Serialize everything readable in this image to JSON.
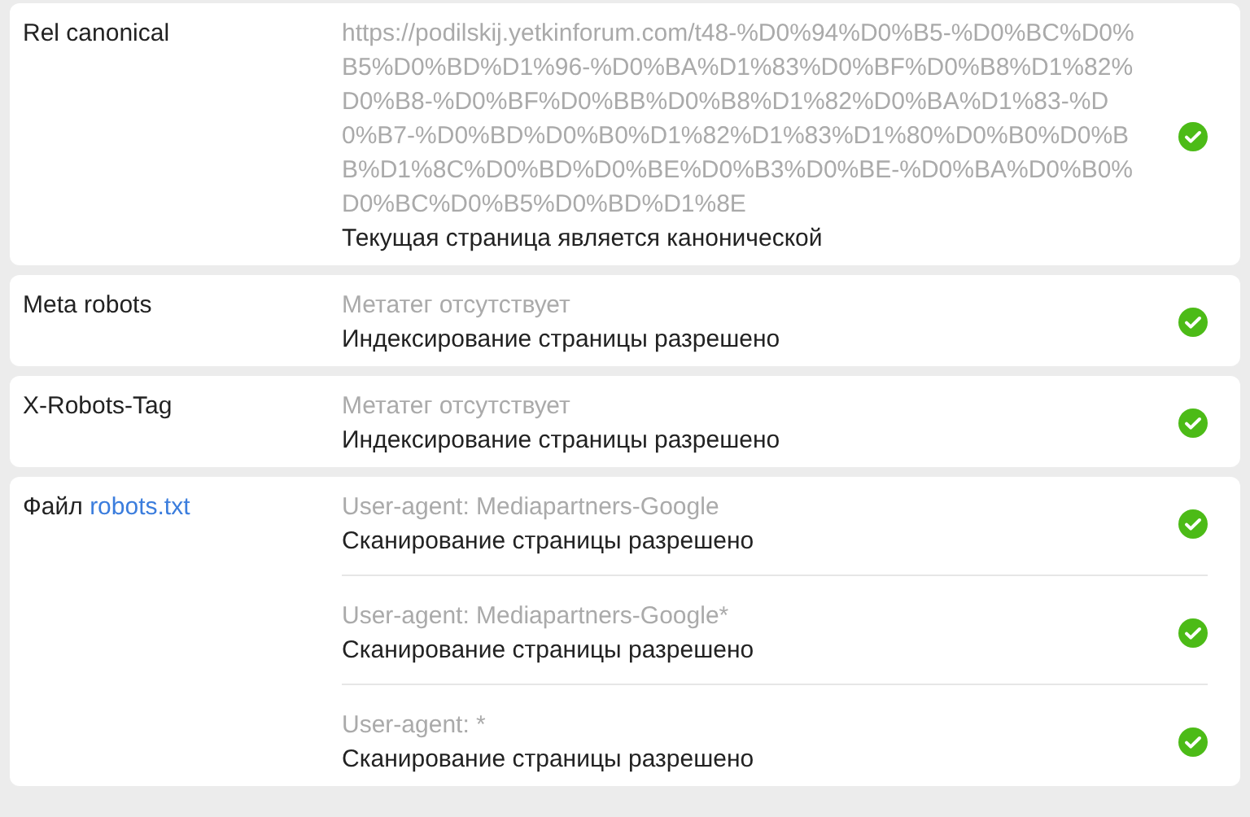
{
  "rows": [
    {
      "label": "Rel canonical",
      "entries": [
        {
          "detail": "https://podilskij.yetkinforum.com/t48-%D0%94%D0%B5-%D0%BC%D0%B5%D0%BD%D1%96-%D0%BA%D1%83%D0%BF%D0%B8%D1%82%D0%B8-%D0%BF%D0%BB%D0%B8%D1%82%D0%BA%D1%83-%D0%B7-%D0%BD%D0%B0%D1%82%D1%83%D1%80%D0%B0%D0%BB%D1%8C%D0%BD%D0%BE%D0%B3%D0%BE-%D0%BA%D0%B0%D0%BC%D0%B5%D0%BD%D1%8E",
          "result": "Текущая страница является канонической",
          "passed": true
        }
      ]
    },
    {
      "label": "Meta robots",
      "entries": [
        {
          "detail": "Метатег отсутствует",
          "result": "Индексирование страницы разрешено",
          "passed": true
        }
      ]
    },
    {
      "label": "X-Robots-Tag",
      "entries": [
        {
          "detail": "Метатег отсутствует",
          "result": "Индексирование страницы разрешено",
          "passed": true
        }
      ]
    },
    {
      "label": "Файл",
      "link": "robots.txt",
      "entries": [
        {
          "detail": "User-agent: Mediapartners-Google",
          "result": "Сканирование страницы разрешено",
          "passed": true
        },
        {
          "detail": "User-agent: Mediapartners-Google*",
          "result": "Сканирование страницы разрешено",
          "passed": true
        },
        {
          "detail": "User-agent: *",
          "result": "Сканирование страницы разрешено",
          "passed": true
        }
      ]
    }
  ]
}
